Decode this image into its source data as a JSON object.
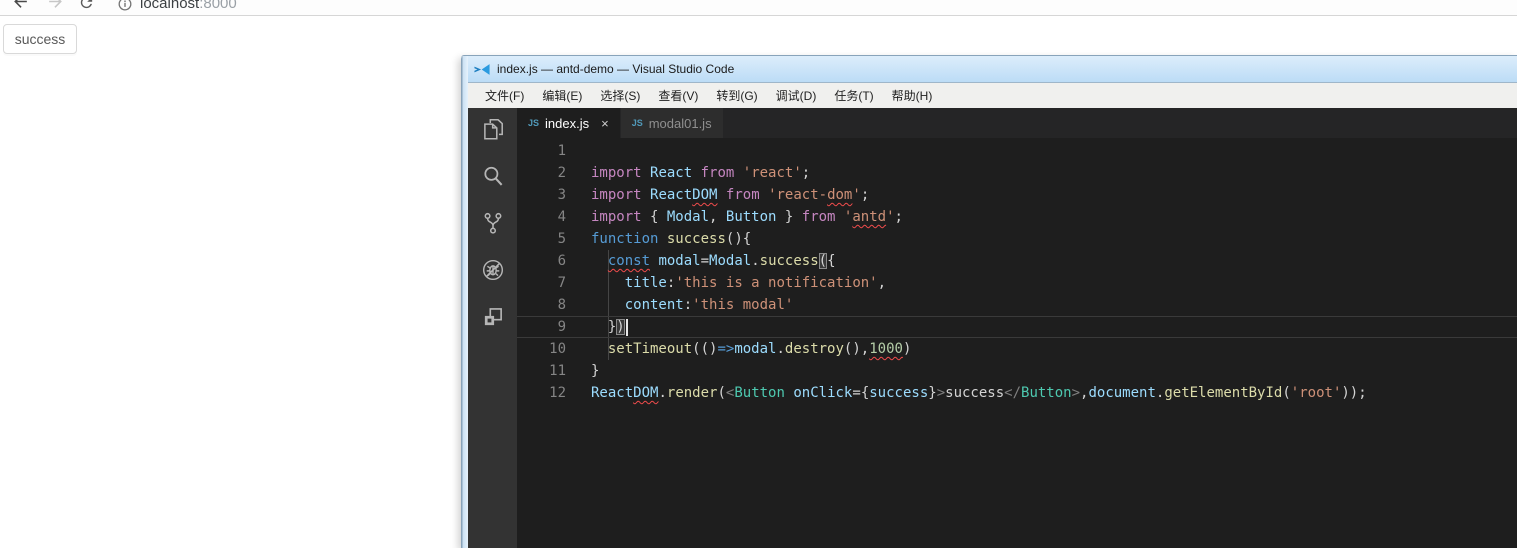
{
  "browser": {
    "url_host": "localhost",
    "url_port": ":8000",
    "page_button": "success",
    "icons": [
      "back-icon",
      "forward-icon",
      "reload-icon",
      "info-icon"
    ]
  },
  "vscode": {
    "title": "index.js — antd-demo — Visual Studio Code",
    "menus": [
      "文件(F)",
      "编辑(E)",
      "选择(S)",
      "查看(V)",
      "转到(G)",
      "调试(D)",
      "任务(T)",
      "帮助(H)"
    ],
    "activity_icons": [
      "explorer-icon",
      "search-icon",
      "source-control-icon",
      "debug-icon",
      "extensions-icon"
    ],
    "js_badge": "JS",
    "tabs": [
      {
        "label": "index.js",
        "active": true,
        "close": "×"
      },
      {
        "label": "modal01.js",
        "active": false
      }
    ],
    "editor": {
      "lines": [
        {
          "n": 1,
          "tokens": []
        },
        {
          "n": 2,
          "tokens": [
            [
              "import",
              "p"
            ],
            [
              " ",
              "d"
            ],
            [
              "React",
              "v"
            ],
            [
              " ",
              "d"
            ],
            [
              "from",
              "p"
            ],
            [
              " ",
              "d"
            ],
            [
              "'react'",
              "s"
            ],
            [
              ";",
              "d"
            ]
          ]
        },
        {
          "n": 3,
          "tokens": [
            [
              "import",
              "p"
            ],
            [
              " ",
              "d"
            ],
            [
              "React",
              "v"
            ],
            [
              "DOM",
              "v",
              "u"
            ],
            [
              " ",
              "d"
            ],
            [
              "from",
              "p"
            ],
            [
              " ",
              "d"
            ],
            [
              "'react-",
              "s"
            ],
            [
              "dom",
              "s",
              "u"
            ],
            [
              "'",
              "s"
            ],
            [
              ";",
              "d"
            ]
          ]
        },
        {
          "n": 4,
          "tokens": [
            [
              "import",
              "p"
            ],
            [
              " { ",
              "d"
            ],
            [
              "Modal",
              "v"
            ],
            [
              ", ",
              "d"
            ],
            [
              "Button",
              "v"
            ],
            [
              " } ",
              "d"
            ],
            [
              "from",
              "p"
            ],
            [
              " ",
              "d"
            ],
            [
              "'",
              "s"
            ],
            [
              "antd",
              "s",
              "u"
            ],
            [
              "'",
              "s"
            ],
            [
              ";",
              "d"
            ]
          ]
        },
        {
          "n": 5,
          "tokens": [
            [
              "function",
              "b"
            ],
            [
              " ",
              "d"
            ],
            [
              "success",
              "f"
            ],
            [
              "(){",
              "d"
            ]
          ]
        },
        {
          "n": 6,
          "tokens": [
            [
              "  ",
              "d"
            ],
            [
              "const",
              "b",
              "u"
            ],
            [
              " ",
              "d"
            ],
            [
              "modal",
              "v"
            ],
            [
              "=",
              "d"
            ],
            [
              "Modal",
              "v"
            ],
            [
              ".",
              "d"
            ],
            [
              "success",
              "f"
            ],
            [
              "(",
              "d",
              "x"
            ],
            [
              "{",
              "d"
            ]
          ]
        },
        {
          "n": 7,
          "tokens": [
            [
              "    ",
              "d"
            ],
            [
              "title",
              "v"
            ],
            [
              ":",
              "d"
            ],
            [
              "'this is a notification'",
              "s"
            ],
            [
              ",",
              "d"
            ]
          ]
        },
        {
          "n": 8,
          "tokens": [
            [
              "    ",
              "d"
            ],
            [
              "content",
              "v"
            ],
            [
              ":",
              "d"
            ],
            [
              "'this modal'",
              "s"
            ]
          ]
        },
        {
          "n": 9,
          "current": true,
          "tokens": [
            [
              "  ",
              "d"
            ],
            [
              "}",
              "d"
            ],
            [
              ")",
              "d",
              "x"
            ],
            [
              "",
              "cursor"
            ]
          ]
        },
        {
          "n": 10,
          "tokens": [
            [
              "  ",
              "d"
            ],
            [
              "setTimeout",
              "f"
            ],
            [
              "(()",
              "d"
            ],
            [
              "=>",
              "b"
            ],
            [
              "modal",
              "v"
            ],
            [
              ".",
              "d"
            ],
            [
              "destroy",
              "f"
            ],
            [
              "(),",
              "d"
            ],
            [
              "1000",
              "n",
              "u"
            ],
            [
              ")",
              "d"
            ]
          ]
        },
        {
          "n": 11,
          "tokens": [
            [
              "}",
              "d"
            ]
          ]
        },
        {
          "n": 12,
          "tokens": [
            [
              "React",
              "v"
            ],
            [
              "DOM",
              "v",
              "u"
            ],
            [
              ".",
              "d"
            ],
            [
              "render",
              "f"
            ],
            [
              "(",
              "d"
            ],
            [
              "<",
              "g"
            ],
            [
              "Button",
              "t"
            ],
            [
              " ",
              "d"
            ],
            [
              "onClick",
              "v"
            ],
            [
              "=",
              "d"
            ],
            [
              "{",
              "d"
            ],
            [
              "success",
              "v"
            ],
            [
              "}",
              "d"
            ],
            [
              ">",
              "g"
            ],
            [
              "success",
              "d"
            ],
            [
              "</",
              "g"
            ],
            [
              "Button",
              "t"
            ],
            [
              ">",
              "g"
            ],
            [
              ",",
              "d"
            ],
            [
              "document",
              "v"
            ],
            [
              ".",
              "d"
            ],
            [
              "getElementById",
              "f"
            ],
            [
              "(",
              "d"
            ],
            [
              "'root'",
              "s"
            ],
            [
              "));",
              "d"
            ]
          ]
        }
      ]
    },
    "colors": {
      "titlebar": "#bcdcf6",
      "menubar": "#f0f0ee",
      "activity_bar": "#333333",
      "editor_bg": "#1e1e1e",
      "tabbar_bg": "#252526",
      "squiggle": "#f14c4c",
      "js_icon": "#519aba"
    }
  }
}
